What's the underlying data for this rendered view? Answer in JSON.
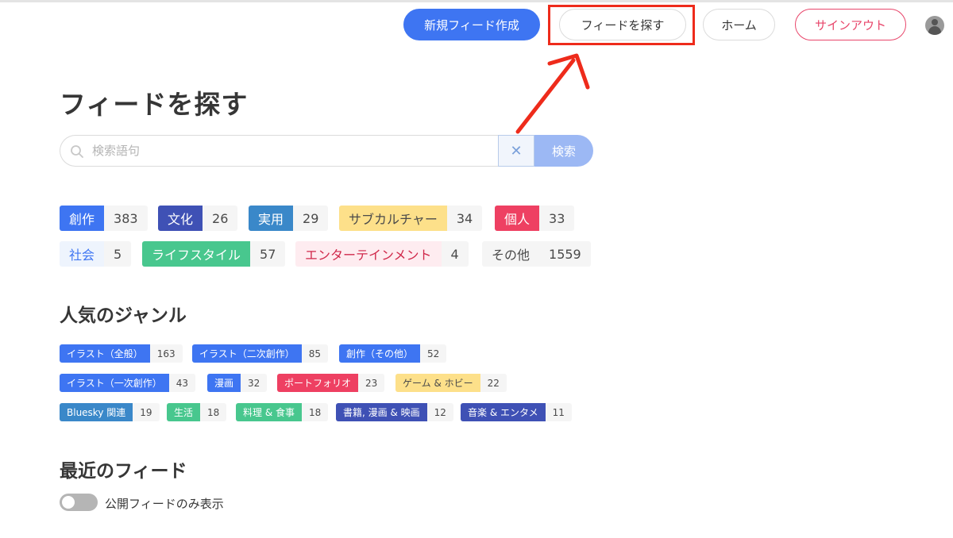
{
  "header": {
    "new_feed_label": "新規フィード作成",
    "find_feed_label": "フィードを探す",
    "home_label": "ホーム",
    "signout_label": "サインアウト"
  },
  "page": {
    "title": "フィードを探す"
  },
  "search": {
    "placeholder": "検索語句",
    "value": "",
    "clear_label": "✕",
    "submit_label": "検索"
  },
  "categories": [
    {
      "label": "創作",
      "count": "383",
      "bg": "#3e75f2",
      "fg": "#ffffff"
    },
    {
      "label": "文化",
      "count": "26",
      "bg": "#3f51b5",
      "fg": "#ffffff"
    },
    {
      "label": "実用",
      "count": "29",
      "bg": "#3a88c9",
      "fg": "#ffffff"
    },
    {
      "label": "サブカルチャー",
      "count": "34",
      "bg": "#fde08a",
      "fg": "#4a4a4a"
    },
    {
      "label": "個人",
      "count": "33",
      "bg": "#ee4062",
      "fg": "#ffffff"
    },
    {
      "label": "社会",
      "count": "5",
      "bg": "#eef4fd",
      "fg": "#3e75f2"
    },
    {
      "label": "ライフスタイル",
      "count": "57",
      "bg": "#48c78e",
      "fg": "#ffffff"
    },
    {
      "label": "エンターテインメント",
      "count": "4",
      "bg": "#feecf0",
      "fg": "#d0294b"
    },
    {
      "label": "その他",
      "count": "1559",
      "bg": "#f5f5f5",
      "fg": "#4a4a4a"
    }
  ],
  "genres_section": {
    "title": "人気のジャンル"
  },
  "genres": [
    {
      "label": "イラスト（全般）",
      "count": "163",
      "bg": "#3e75f2",
      "fg": "#ffffff"
    },
    {
      "label": "イラスト（二次創作）",
      "count": "85",
      "bg": "#3e75f2",
      "fg": "#ffffff"
    },
    {
      "label": "創作（その他）",
      "count": "52",
      "bg": "#3e75f2",
      "fg": "#ffffff"
    },
    {
      "label": "イラスト（一次創作）",
      "count": "43",
      "bg": "#3e75f2",
      "fg": "#ffffff"
    },
    {
      "label": "漫画",
      "count": "32",
      "bg": "#3e75f2",
      "fg": "#ffffff"
    },
    {
      "label": "ポートフォリオ",
      "count": "23",
      "bg": "#ee4062",
      "fg": "#ffffff"
    },
    {
      "label": "ゲーム & ホビー",
      "count": "22",
      "bg": "#fde08a",
      "fg": "#4a4a4a"
    },
    {
      "label": "Bluesky 関連",
      "count": "19",
      "bg": "#3a88c9",
      "fg": "#ffffff"
    },
    {
      "label": "生活",
      "count": "18",
      "bg": "#48c78e",
      "fg": "#ffffff"
    },
    {
      "label": "料理 & 食事",
      "count": "18",
      "bg": "#48c78e",
      "fg": "#ffffff"
    },
    {
      "label": "書籍, 漫画 & 映画",
      "count": "12",
      "bg": "#3f51b5",
      "fg": "#ffffff"
    },
    {
      "label": "音楽 & エンタメ",
      "count": "11",
      "bg": "#3f51b5",
      "fg": "#ffffff"
    }
  ],
  "recent_section": {
    "title": "最近のフィード",
    "toggle_label": "公開フィードのみ表示",
    "toggle_on": false
  },
  "annotation": {
    "color": "#ee2b1b"
  }
}
